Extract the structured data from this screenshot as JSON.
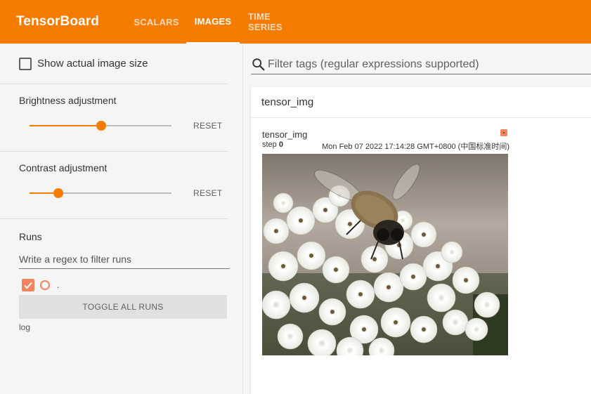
{
  "header": {
    "brand": "TensorBoard",
    "tabs": [
      {
        "label": "SCALARS",
        "active": false
      },
      {
        "label": "IMAGES",
        "active": true
      },
      {
        "label": "TIME SERIES",
        "active": false
      }
    ],
    "accent_color": "#f57c00"
  },
  "sidebar": {
    "show_actual_size": {
      "label": "Show actual image size",
      "checked": false
    },
    "brightness": {
      "title": "Brightness adjustment",
      "reset_label": "RESET",
      "value_fraction": 0.5
    },
    "contrast": {
      "title": "Contrast adjustment",
      "reset_label": "RESET",
      "value_fraction": 0.2
    },
    "runs": {
      "title": "Runs",
      "filter_placeholder": "Write a regex to filter runs",
      "items": [
        {
          "name": ".",
          "checked": true,
          "color": "#f4845f"
        }
      ],
      "toggle_all_label": "TOGGLE ALL RUNS",
      "log_dir": "log"
    }
  },
  "main": {
    "search_placeholder": "Filter tags (regular expressions supported)",
    "card": {
      "title": "tensor_img",
      "image": {
        "tag": "tensor_img",
        "step_label": "step",
        "step": "0",
        "timestamp": "Mon Feb 07 2022 17:14:28 GMT+0800 (中国标准时间)",
        "run_color": "#f4845f"
      }
    }
  }
}
